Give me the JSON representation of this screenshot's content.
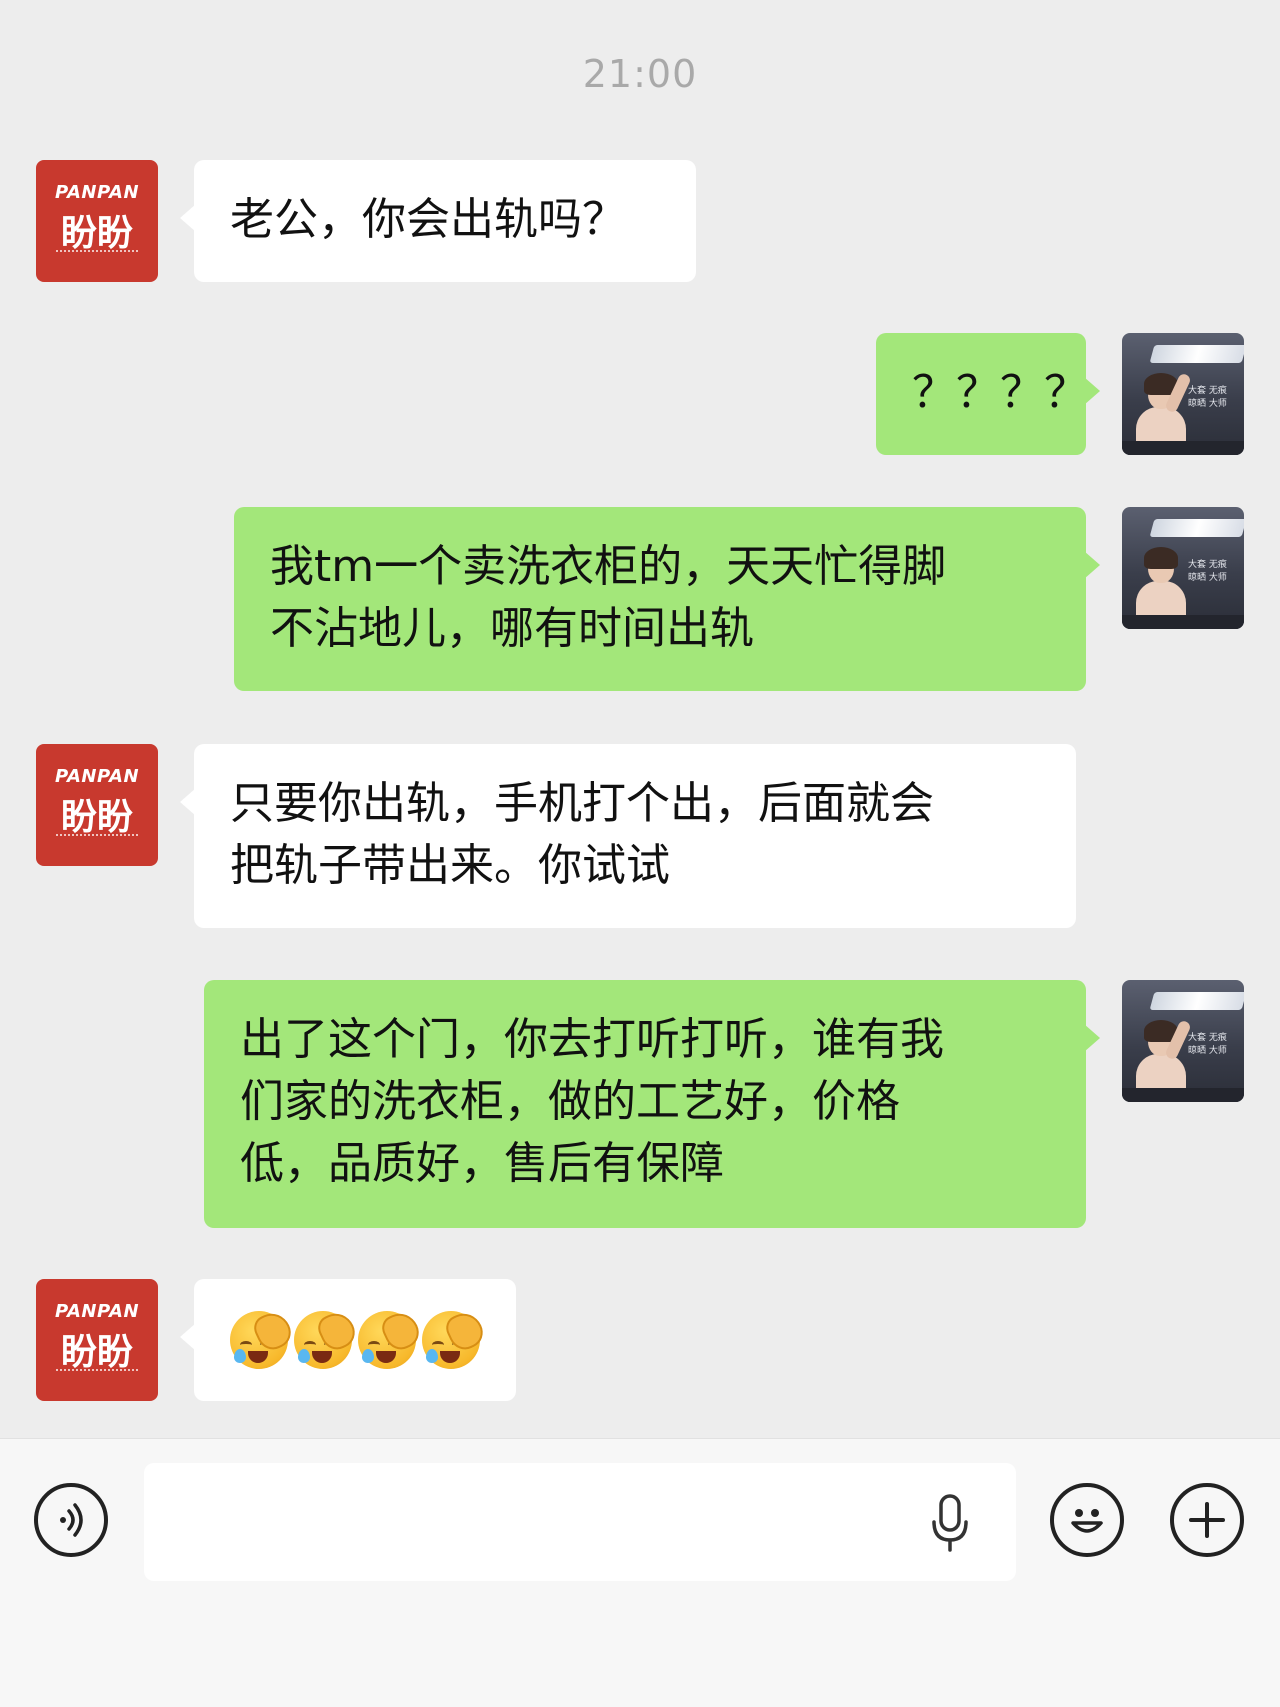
{
  "chat": {
    "timestamp": "21:00",
    "contacts": {
      "brand_avatar": {
        "name_en": "PANPAN",
        "name_cn": "盼盼",
        "color": "#c8392e"
      },
      "self_avatar": {
        "ad_text": "大套 无痕\n晾晒 大师"
      }
    },
    "messages": [
      {
        "side": "left",
        "sender": "brand",
        "text": "老公，你会出轨吗？"
      },
      {
        "side": "right",
        "sender": "self",
        "text": "？？？？"
      },
      {
        "side": "right",
        "sender": "self",
        "text": "我tm一个卖洗衣柜的，天天忙得脚\n不沾地儿，哪有时间出轨"
      },
      {
        "side": "left",
        "sender": "brand",
        "text": "只要你出轨，手机打个出，后面就会\n把轨子带出来。你试试"
      },
      {
        "side": "right",
        "sender": "self",
        "text": "出了这个门，你去打听打听，谁有我\n们家的洗衣柜，做的工艺好，价格\n低，品质好，售后有保障"
      },
      {
        "side": "left",
        "sender": "brand",
        "emoji": [
          "facepalm-crying-icon",
          "facepalm-crying-icon",
          "facepalm-crying-icon",
          "facepalm-crying-icon"
        ]
      }
    ]
  },
  "input_bar": {
    "voice_icon": "voice-icon",
    "mic_icon": "mic-icon",
    "emoji_icon": "smile-icon",
    "plus_icon": "plus-icon",
    "input_value": ""
  },
  "colors": {
    "background": "#ededed",
    "bubble_self": "#a3e77a",
    "bubble_other": "#ffffff",
    "timestamp": "#a9a9a9"
  }
}
